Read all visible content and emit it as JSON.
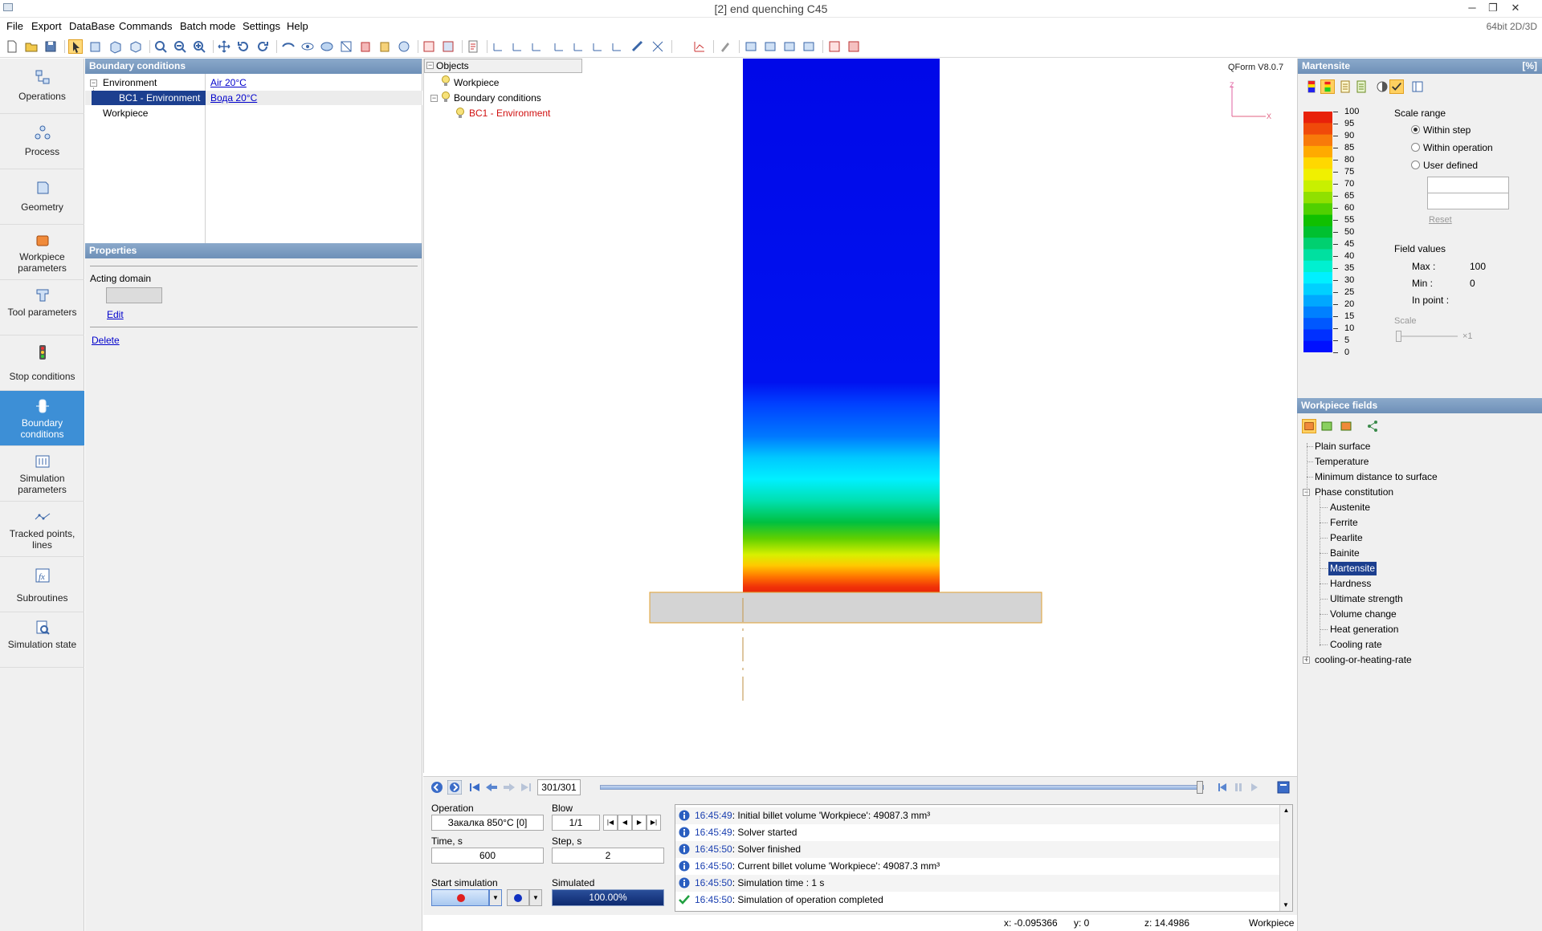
{
  "window": {
    "title": "[2] end quenching C45",
    "edition": "64bit 2D/3D",
    "buttons": {
      "minimize": "─",
      "restore": "❐",
      "close": "✕"
    }
  },
  "menu": [
    "File",
    "Export",
    "DataBase",
    "Commands",
    "Batch mode",
    "Settings",
    "Help"
  ],
  "nav": [
    {
      "label": "Operations",
      "icon": "operations-icon"
    },
    {
      "label": "Process",
      "icon": "process-icon"
    },
    {
      "label": "Geometry",
      "icon": "geometry-icon"
    },
    {
      "label": "Workpiece parameters",
      "icon": "workpiece-icon"
    },
    {
      "label": "Tool parameters",
      "icon": "tool-icon"
    },
    {
      "label": "Stop conditions",
      "icon": "traffic-light-icon"
    },
    {
      "label": "Boundary conditions",
      "icon": "boundary-icon",
      "active": true
    },
    {
      "label": "Simulation parameters",
      "icon": "simulation-params-icon"
    },
    {
      "label": "Tracked points, lines",
      "icon": "tracked-points-icon"
    },
    {
      "label": "Subroutines",
      "icon": "function-icon"
    },
    {
      "label": "Simulation state",
      "icon": "simulation-state-icon"
    }
  ],
  "boundary_conditions": {
    "header": "Boundary conditions",
    "environment": "Environment",
    "environment_value": "Air 20°C",
    "bc1": "BC1 - Environment",
    "bc1_value": "Вода 20°C",
    "workpiece": "Workpiece"
  },
  "properties": {
    "header": "Properties",
    "acting_domain": "Acting domain",
    "edit": "Edit",
    "delete": "Delete"
  },
  "objects": {
    "header": "Objects",
    "workpiece": "Workpiece",
    "boundary_conditions": "Boundary conditions",
    "bc1": "BC1 - Environment"
  },
  "viewport": {
    "version": "QForm V8.0.7",
    "axis_z": "Z",
    "axis_x": "X"
  },
  "playback": {
    "frame": "301/301"
  },
  "simulation": {
    "operation_label": "Operation",
    "operation_value": "Закалка 850°C [0]",
    "blow_label": "Blow",
    "blow_value": "1/1",
    "time_label": "Time, s",
    "time_value": "600",
    "step_label": "Step, s",
    "step_value": "2",
    "start_label": "Start simulation",
    "simulated_label": "Simulated",
    "progress": "100.00%"
  },
  "log": [
    {
      "time": "16:45:49",
      "text": ": Initial billet volume 'Workpiece': 49087.3 mm³",
      "type": "info"
    },
    {
      "time": "16:45:49",
      "text": ": Solver started",
      "type": "info"
    },
    {
      "time": "16:45:50",
      "text": ": Solver finished",
      "type": "info"
    },
    {
      "time": "16:45:50",
      "text": ": Current billet volume 'Workpiece': 49087.3 mm³",
      "type": "info"
    },
    {
      "time": "16:45:50",
      "text": ": Simulation time : 1 s",
      "type": "info"
    },
    {
      "time": "16:45:50",
      "text": ": Simulation of operation completed",
      "type": "success"
    }
  ],
  "status": {
    "x": "x: -0.095366",
    "y": "y: 0",
    "z": "z: 14.4986",
    "object": "Workpiece"
  },
  "field_panel": {
    "header": "Martensite",
    "unit": "[%]",
    "scale_labels": [
      "100",
      "95",
      "90",
      "85",
      "80",
      "75",
      "70",
      "65",
      "60",
      "55",
      "50",
      "45",
      "40",
      "35",
      "30",
      "25",
      "20",
      "15",
      "10",
      "5",
      "0"
    ],
    "scale_range_label": "Scale range",
    "within_step": "Within step",
    "within_operation": "Within operation",
    "user_defined": "User defined",
    "reset": "Reset",
    "field_values_label": "Field values",
    "max_label": "Max :",
    "max_value": "100",
    "min_label": "Min :",
    "min_value": "0",
    "in_point_label": "In point :",
    "scale_label": "Scale",
    "scale_mult": "×1",
    "colors": [
      "#e8220a",
      "#f04a0a",
      "#f87a0a",
      "#ffaa00",
      "#ffd800",
      "#f0f000",
      "#c8f000",
      "#90e000",
      "#50d000",
      "#10c000",
      "#00c030",
      "#00d070",
      "#00e0a0",
      "#00f0d0",
      "#00f0ff",
      "#00d0ff",
      "#00a8ff",
      "#0080ff",
      "#0058ff",
      "#0030ff",
      "#0010ff"
    ]
  },
  "workpiece_fields": {
    "header": "Workpiece fields",
    "items": [
      {
        "label": "Plain surface",
        "level": 0
      },
      {
        "label": "Temperature",
        "level": 0
      },
      {
        "label": "Minimum distance to surface",
        "level": 0
      },
      {
        "label": "Phase constitution",
        "level": 0,
        "expanded": true
      },
      {
        "label": "Austenite",
        "level": 1
      },
      {
        "label": "Ferrite",
        "level": 1
      },
      {
        "label": "Pearlite",
        "level": 1
      },
      {
        "label": "Bainite",
        "level": 1
      },
      {
        "label": "Martensite",
        "level": 1,
        "selected": true
      },
      {
        "label": "Hardness",
        "level": 1
      },
      {
        "label": "Ultimate strength",
        "level": 1
      },
      {
        "label": "Volume change",
        "level": 1
      },
      {
        "label": "Heat generation",
        "level": 1
      },
      {
        "label": "Cooling rate",
        "level": 1
      },
      {
        "label": "cooling-or-heating-rate",
        "level": 0,
        "collapsed": true
      }
    ]
  }
}
